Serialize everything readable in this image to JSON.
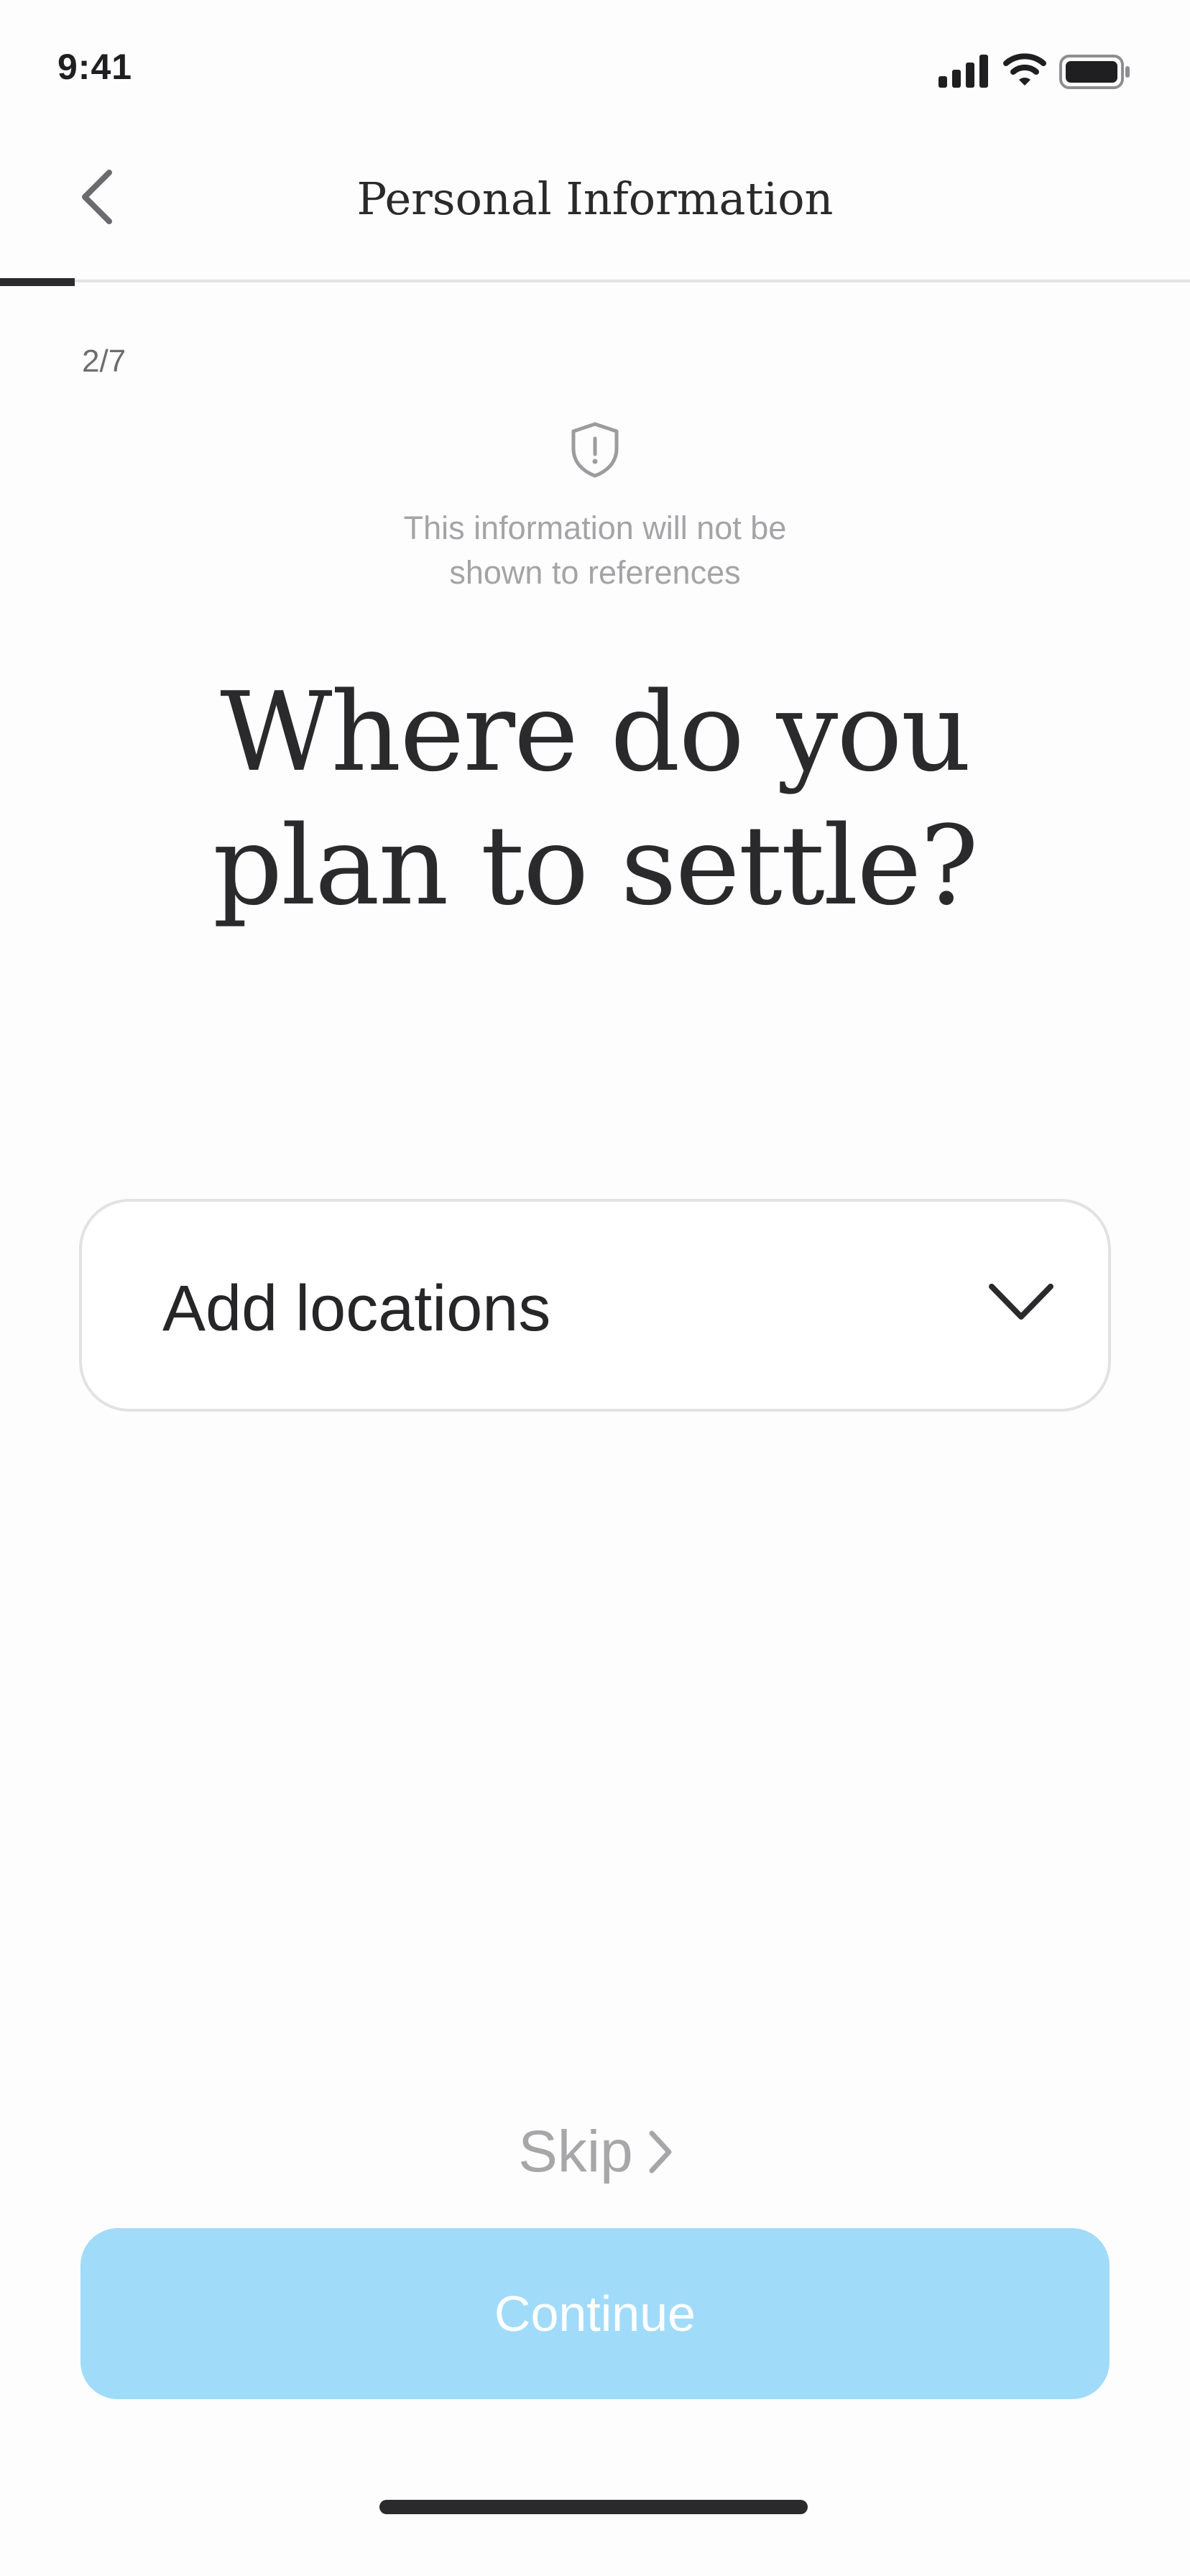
{
  "status_bar": {
    "time": "9:41",
    "signal_icon": "cellular-signal-icon",
    "wifi_icon": "wifi-icon",
    "battery_icon": "battery-icon"
  },
  "header": {
    "back_icon": "chevron-left-icon",
    "title": "Personal Information"
  },
  "progress": {
    "current_step": 2,
    "total_steps": 7,
    "fraction": 0.0625,
    "label": "2/7"
  },
  "privacy": {
    "icon": "shield-alert-icon",
    "line1": "This information will not be",
    "line2": "shown to references"
  },
  "question": {
    "line1": "Where do you",
    "line2": "plan to settle?"
  },
  "locations_dropdown": {
    "label": "Add locations",
    "icon": "chevron-down-icon"
  },
  "skip": {
    "label": "Skip",
    "icon": "chevron-right-icon"
  },
  "continue_button": {
    "label": "Continue",
    "state": "disabled"
  },
  "colors": {
    "accent_disabled": "#a1dbfa",
    "text_primary": "#2a2a2c",
    "text_muted": "#a4a4a8",
    "border": "#e2e2e4"
  }
}
